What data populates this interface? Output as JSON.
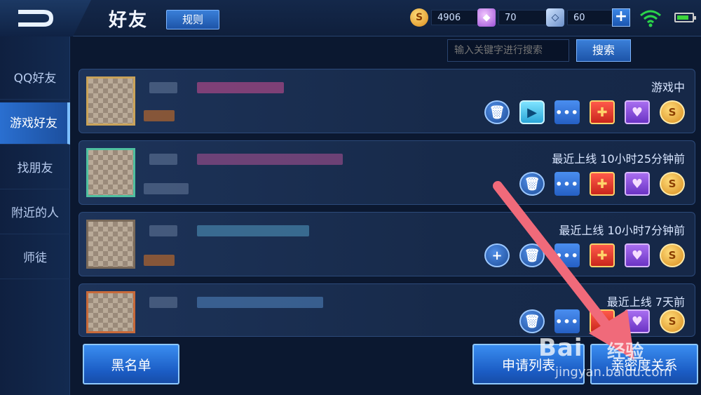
{
  "header": {
    "title": "好友",
    "rules_label": "规则",
    "currencies": [
      {
        "icon": "gold-coin-icon",
        "value": "4906"
      },
      {
        "icon": "purple-diamond-icon",
        "value": "70"
      },
      {
        "icon": "voucher-crystal-icon",
        "value": "60"
      }
    ],
    "add_label": "+"
  },
  "sidebar": {
    "items": [
      {
        "label": "QQ好友"
      },
      {
        "label": "游戏好友"
      },
      {
        "label": "找朋友"
      },
      {
        "label": "附近的人"
      },
      {
        "label": "师徒"
      }
    ],
    "active_index": 1
  },
  "search": {
    "placeholder": "输入关键字进行搜索",
    "button_label": "搜索"
  },
  "friends": [
    {
      "status": "游戏中"
    },
    {
      "status": "最近上线  10小时25分钟前"
    },
    {
      "status": "最近上线  10小时7分钟前"
    },
    {
      "status": "最近上线  7天前"
    }
  ],
  "footer": {
    "blacklist_label": "黑名单",
    "requests_label": "申请列表",
    "intimacy_label": "亲密度关系"
  },
  "watermark": {
    "brand": "Bai",
    "sub": "经验",
    "url": "jingyan.baidu.com"
  },
  "colors": {
    "accent": "#3a7fd8",
    "background": "#0b1830",
    "arrow": "#f06a7a"
  }
}
